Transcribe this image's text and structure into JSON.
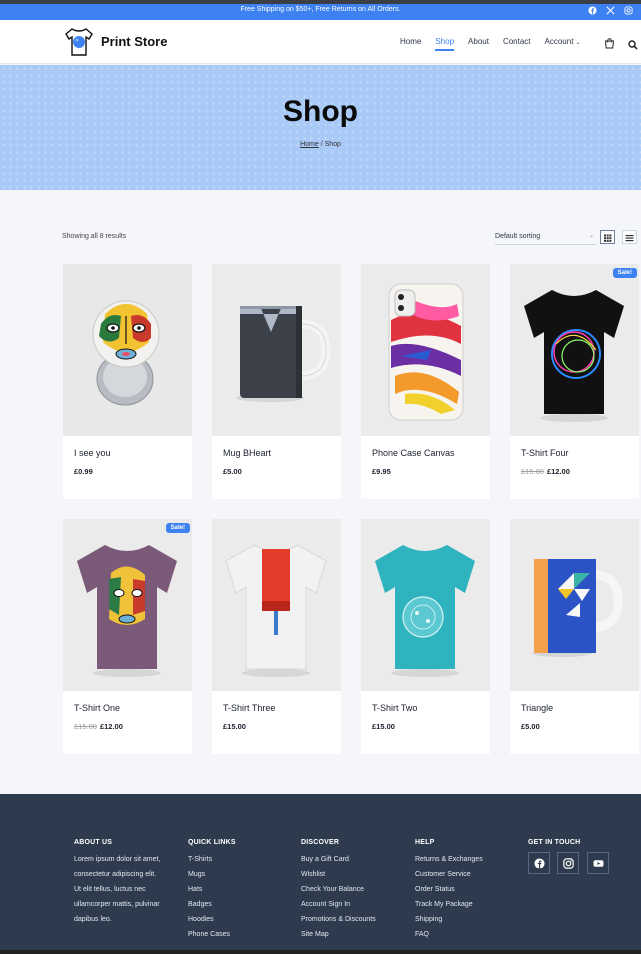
{
  "announcement": {
    "text": "Free Shipping on $50+, Free Returns on All Orders.",
    "social_icons": [
      "facebook-icon",
      "x-icon",
      "instagram-icon"
    ]
  },
  "header": {
    "brand": "Print Store",
    "nav": [
      {
        "label": "Home",
        "active": false
      },
      {
        "label": "Shop",
        "active": true
      },
      {
        "label": "About",
        "active": false
      },
      {
        "label": "Contact",
        "active": false
      },
      {
        "label": "Account",
        "active": false
      }
    ],
    "icons": [
      "cart-icon",
      "search-icon"
    ]
  },
  "hero": {
    "title": "Shop",
    "breadcrumb_home": "Home",
    "breadcrumb_current": " / Shop"
  },
  "shop": {
    "result_count": "Showing all 8 results",
    "sort_selected": "Default sorting",
    "view_modes": [
      "grid-view-icon",
      "list-view-icon"
    ]
  },
  "products": [
    {
      "name": "I see you",
      "price": "£0.99",
      "old_price": "",
      "sale": ""
    },
    {
      "name": "Mug BHeart",
      "price": "£5.00",
      "old_price": "",
      "sale": ""
    },
    {
      "name": "Phone Case Canvas",
      "price": "£9.95",
      "old_price": "",
      "sale": ""
    },
    {
      "name": "T-Shirt Four",
      "price": "£12.00",
      "old_price": "£15.00",
      "sale": "Sale!"
    },
    {
      "name": "T-Shirt One",
      "price": "£12.00",
      "old_price": "£15.00",
      "sale": "Sale!"
    },
    {
      "name": "T-Shirt Three",
      "price": "£15.00",
      "old_price": "",
      "sale": ""
    },
    {
      "name": "T-Shirt Two",
      "price": "£15.00",
      "old_price": "",
      "sale": ""
    },
    {
      "name": "Triangle",
      "price": "£5.00",
      "old_price": "",
      "sale": ""
    }
  ],
  "footer": {
    "about": {
      "title": "ABOUT US",
      "text": "Lorem ipsum dolor sit amet, consectetur adipiscing elit. Ut elit tellus, luctus nec ullamcorper mattis, pulvinar dapibus leo."
    },
    "quick_links": {
      "title": "QUICK LINKS",
      "links": [
        "T-Shirts",
        "Mugs",
        "Hats",
        "Badges",
        "Hoodies",
        "Phone Cases"
      ]
    },
    "discover": {
      "title": "DISCOVER",
      "links": [
        "Buy a Gift Card",
        "Wishlist",
        "Check Your Balance",
        "Account Sign In",
        "Promotions & Discounts",
        "Site Map"
      ]
    },
    "help": {
      "title": "HELP",
      "links": [
        "Returns & Exchanges",
        "Customer Service",
        "Order Status",
        "Track My Package",
        "Shipping",
        "FAQ"
      ]
    },
    "contact": {
      "title": "GET IN TOUCH",
      "social": [
        "facebook-icon",
        "instagram-icon",
        "youtube-icon"
      ]
    }
  },
  "colors": {
    "accent": "#3d82f0",
    "hero_bg": "#a9c9f7",
    "footer_bg": "#2e3b4e",
    "page_bg": "#f4f6f9"
  }
}
